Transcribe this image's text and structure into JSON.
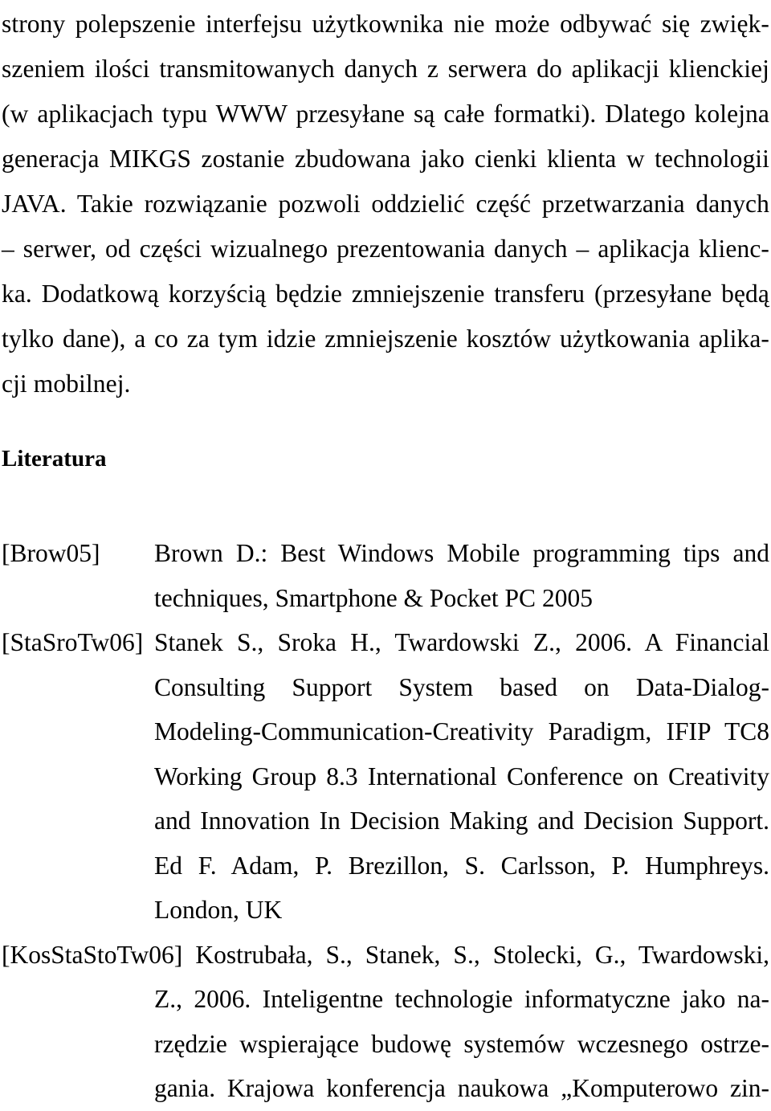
{
  "document": {
    "language": "pl",
    "paragraph": {
      "name": "continuation-paragraph",
      "lines": [
        "strony polepszenie interfejsu użytkownika nie może odbywać się zwięk-",
        "szeniem ilości transmitowanych danych z serwera do aplikacji klienckiej",
        "(w aplikacjach typu WWW przesyłane są całe formatki). Dlatego kolejna",
        "generacja MIKGS zostanie zbudowana jako cienki klienta w technologii",
        "JAVA. Takie rozwiązanie pozwoli oddzielić część przetwarzania danych",
        "– serwer, od części wizualnego prezentowania danych – aplikacja klienc-",
        "ka. Dodatkową korzyścią będzie zmniejszenie transferu (przesyłane będą",
        "tylko dane), a co za tym idzie zmniejszenie kosztów użytkowania aplika-",
        "cji mobilnej."
      ],
      "full_text": "strony polepszenie interfejsu użytkownika nie może odbywać się zwiększeniem ilości transmitowanych danych z serwera do aplikacji klienckiej (w aplikacjach typu WWW przesyłane są całe formatki). Dlatego kolejna generacja MIKGS zostanie zbudowana jako cienki klienta w technologii JAVA. Takie rozwiązanie pozwoli oddzielić część przetwarzania danych – serwer, od części wizualnego prezentowania danych – aplikacja klienc-ka. Dodatkową korzyścią będzie zmniejszenie transferu (przesyłane będą tylko dane), a co za tym idzie zmniejszenie kosztów użytkowania aplikacji mobilnej."
    },
    "heading": {
      "name": "literatura-heading",
      "text": "Literatura"
    },
    "references": [
      {
        "tag": "[Brow05]",
        "lines": [
          "Brown D.: Best Windows Mobile programming tips and",
          "techniques, Smartphone & Pocket PC 2005"
        ],
        "full_text": "Brown D.: Best Windows Mobile programming tips and techniques, Smartphone & Pocket PC 2005"
      },
      {
        "tag": "[StaSroTw06]",
        "lines": [
          "Stanek S., Sroka H., Twardowski Z., 2006. A Financial",
          "Consulting Support System based on Data-Dialog-",
          "Modeling-Communication-Creativity Paradigm, IFIP TC8",
          "Working Group 8.3 International Conference on Creativity",
          "and Innovation In Decision Making and Decision Support.",
          "Ed F. Adam, P. Brezillon, S. Carlsson, P. Humphreys.",
          "London, UK"
        ],
        "full_text": "Stanek S., Sroka H., Twardowski Z., 2006. A Financial Consulting Support System based on Data-Dialog-Modeling-Communication-Creativity Paradigm, IFIP TC8 Working Group 8.3 International Conference on Creativity and Innovation In Decision Making and Decision Support. Ed F. Adam, P. Brezillon, S. Carlsson, P. Humphreys. London, UK"
      },
      {
        "tag": "[KosStaStoTw06]",
        "lines": [
          "Kostrubała, S., Stanek, S., Stolecki, G., Twardowski,",
          "Z., 2006. Inteligentne technologie informatyczne jako na-",
          "rzędzie wspierające budowę systemów wczesnego ostrze-",
          "gania. Krajowa konferencja naukowa „Komputerowo zin-"
        ],
        "full_text": "Kostrubała, S., Stanek, S., Stolecki, G., Twardowski, Z., 2006. Inteligentne technologie informatyczne jako narzędzie wspierające budowę systemów wczesnego ostrzegania. Krajowa konferencja naukowa „Komputerowo zin-"
      }
    ]
  }
}
